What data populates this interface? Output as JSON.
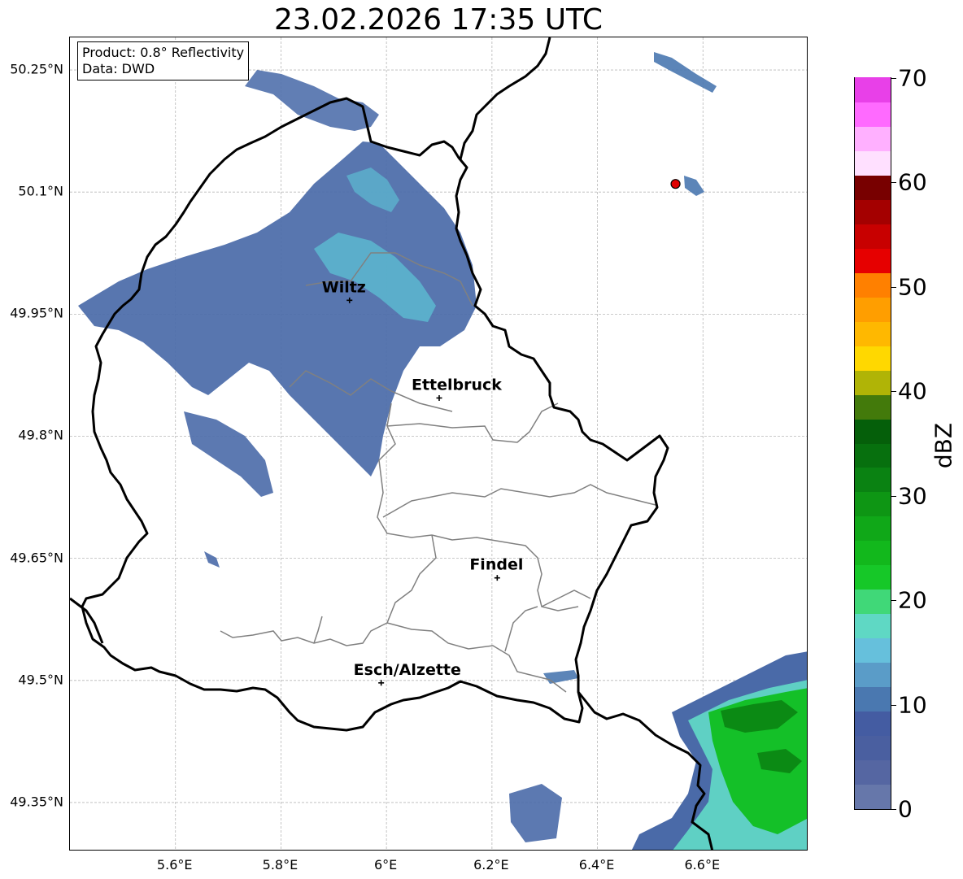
{
  "title": "23.02.2026 17:35 UTC",
  "info": {
    "product": "Product: 0.8° Reflectivity",
    "source": "Data: DWD"
  },
  "map_extent": {
    "lon_min": 5.4,
    "lon_max": 6.8,
    "lat_min": 49.29,
    "lat_max": 50.29
  },
  "x_ticks": [
    {
      "lon": 5.6,
      "label": "5.6°E"
    },
    {
      "lon": 5.8,
      "label": "5.8°E"
    },
    {
      "lon": 6.0,
      "label": "6°E"
    },
    {
      "lon": 6.2,
      "label": "6.2°E"
    },
    {
      "lon": 6.4,
      "label": "6.4°E"
    },
    {
      "lon": 6.6,
      "label": "6.6°E"
    }
  ],
  "y_ticks": [
    {
      "lat": 50.25,
      "label": "50.25°N"
    },
    {
      "lat": 50.1,
      "label": "50.1°N"
    },
    {
      "lat": 49.95,
      "label": "49.95°N"
    },
    {
      "lat": 49.8,
      "label": "49.8°N"
    },
    {
      "lat": 49.65,
      "label": "49.65°N"
    },
    {
      "lat": 49.5,
      "label": "49.5°N"
    },
    {
      "lat": 49.35,
      "label": "49.35°N"
    }
  ],
  "cities": [
    {
      "name": "Wiltz",
      "lon": 5.93,
      "lat": 49.967
    },
    {
      "name": "Ettelbruck",
      "lon": 6.1,
      "lat": 49.847
    },
    {
      "name": "Findel",
      "lon": 6.21,
      "lat": 49.626
    },
    {
      "name": "Esch/Alzette",
      "lon": 5.99,
      "lat": 49.497
    }
  ],
  "radar_site": {
    "lon": 6.548,
    "lat": 50.11,
    "color": "#e00000"
  },
  "colorbar": {
    "label": "dBZ",
    "min": 0,
    "max": 70,
    "ticks": [
      "0",
      "10",
      "20",
      "30",
      "40",
      "50",
      "60",
      "70"
    ],
    "colors": [
      "#6677aa",
      "#5566a2",
      "#4a5fa0",
      "#445ca2",
      "#4a78b0",
      "#5a9cc8",
      "#66c0dc",
      "#5fd8c4",
      "#40d878",
      "#16c828",
      "#12b81c",
      "#10a818",
      "#0e9614",
      "#0a8212",
      "#07700e",
      "#055f0a",
      "#437a0b",
      "#b0b406",
      "#ffd800",
      "#ffb800",
      "#ff9e00",
      "#ff8000",
      "#e60000",
      "#c80000",
      "#a40000",
      "#780000",
      "#ffe0ff",
      "#ffb0ff",
      "#ff6aff",
      "#e840e8"
    ]
  },
  "colors": {
    "country_border": "#000000",
    "canton_border": "#808080",
    "grid": "#b8b8b8"
  }
}
